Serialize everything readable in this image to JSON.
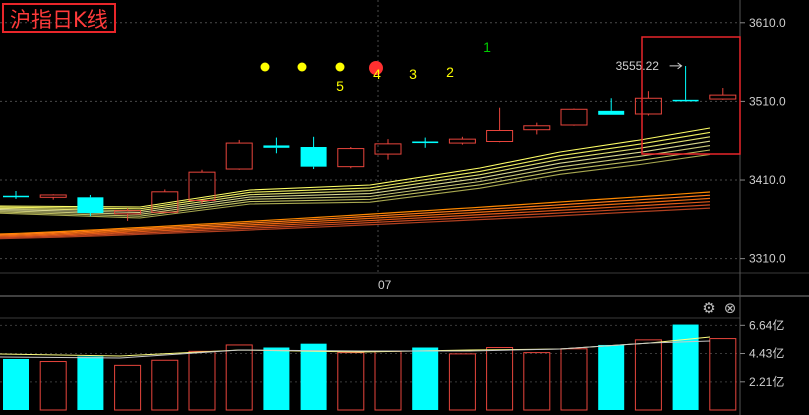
{
  "title": "沪指日K线",
  "colors": {
    "up": "#e8453c",
    "down": "#00ffff",
    "ma_yellow": [
      "#ffff66",
      "#f0f060",
      "#e0e070",
      "#d8d890",
      "#c8c878",
      "#bdbd60",
      "#a8a850"
    ],
    "ma_orange": [
      "#ff8800",
      "#ff7a1a",
      "#ee6a10",
      "#e05a1a",
      "#c84a20",
      "#b04020"
    ],
    "vol_ma": [
      "#ffff80",
      "#c8c8c8"
    ],
    "highlight_box": "#e8262a",
    "marker": "#ffff00",
    "marker_red": "#ff3030"
  },
  "price_axis": {
    "ticks": [
      "3610.0",
      "3510.0",
      "3410.0",
      "3310.0"
    ]
  },
  "volume_axis": {
    "ticks": [
      "6.64亿",
      "4.43亿",
      "2.21亿"
    ]
  },
  "x_labels": [
    "07"
  ],
  "annotation": "3555.22",
  "sequence_labels": [
    {
      "text": "5",
      "color": "#ffff00"
    },
    {
      "text": "4",
      "color": "#ffff00"
    },
    {
      "text": "3",
      "color": "#ffff00"
    },
    {
      "text": "2",
      "color": "#ffff00"
    },
    {
      "text": "1",
      "color": "#00cc00"
    }
  ],
  "chart_data": {
    "type": "candlestick",
    "title": "沪指日K线",
    "ylim": [
      3293,
      3639
    ],
    "x_marker": "07",
    "candles": [
      {
        "o": 3390,
        "h": 3396,
        "l": 3386,
        "c": 3390,
        "dir": "down"
      },
      {
        "o": 3388,
        "h": 3392,
        "l": 3385,
        "c": 3391,
        "dir": "up"
      },
      {
        "o": 3388,
        "h": 3391,
        "l": 3364,
        "c": 3368,
        "dir": "down"
      },
      {
        "o": 3367,
        "h": 3374,
        "l": 3358,
        "c": 3371,
        "dir": "up"
      },
      {
        "o": 3369,
        "h": 3398,
        "l": 3368,
        "c": 3395,
        "dir": "up"
      },
      {
        "o": 3384,
        "h": 3423,
        "l": 3380,
        "c": 3420,
        "dir": "up"
      },
      {
        "o": 3424,
        "h": 3461,
        "l": 3423,
        "c": 3457,
        "dir": "up"
      },
      {
        "o": 3454,
        "h": 3464,
        "l": 3444,
        "c": 3451,
        "dir": "down"
      },
      {
        "o": 3452,
        "h": 3465,
        "l": 3424,
        "c": 3427,
        "dir": "down"
      },
      {
        "o": 3427,
        "h": 3452,
        "l": 3425,
        "c": 3450,
        "dir": "up"
      },
      {
        "o": 3443,
        "h": 3462,
        "l": 3436,
        "c": 3456,
        "dir": "up"
      },
      {
        "o": 3459,
        "h": 3464,
        "l": 3451,
        "c": 3457,
        "dir": "down"
      },
      {
        "o": 3457,
        "h": 3465,
        "l": 3455,
        "c": 3462,
        "dir": "up"
      },
      {
        "o": 3459,
        "h": 3502,
        "l": 3458,
        "c": 3473,
        "dir": "up"
      },
      {
        "o": 3474,
        "h": 3483,
        "l": 3468,
        "c": 3479,
        "dir": "up"
      },
      {
        "o": 3480,
        "h": 3501,
        "l": 3479,
        "c": 3500,
        "dir": "up"
      },
      {
        "o": 3498,
        "h": 3514,
        "l": 3493,
        "c": 3493,
        "dir": "down"
      },
      {
        "o": 3494,
        "h": 3523,
        "l": 3492,
        "c": 3514,
        "dir": "up"
      },
      {
        "o": 3512,
        "h": 3555,
        "l": 3511,
        "c": 3511,
        "dir": "down"
      },
      {
        "o": 3513,
        "h": 3527,
        "l": 3512,
        "c": 3518,
        "dir": "up"
      }
    ],
    "volume": [
      4.0,
      3.8,
      4.2,
      3.5,
      3.9,
      4.6,
      5.1,
      4.9,
      5.2,
      4.5,
      4.6,
      4.9,
      4.4,
      4.9,
      4.5,
      4.8,
      5.1,
      5.5,
      6.7,
      5.6
    ],
    "volume_unit": "亿"
  }
}
